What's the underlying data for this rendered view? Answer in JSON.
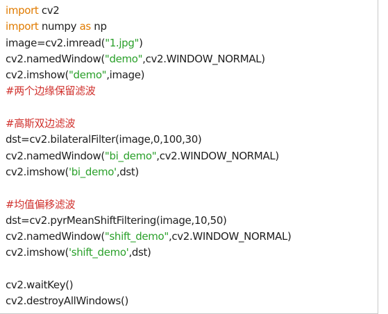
{
  "colors": {
    "keyword": "#e07b00",
    "string": "#2aa02a",
    "comment": "#d0312d",
    "text": "#1e1e1e",
    "background": "#ffffff"
  },
  "code_lines": [
    [
      {
        "t": "kw",
        "v": "import"
      },
      {
        "t": "pl",
        "v": " cv2"
      }
    ],
    [
      {
        "t": "kw",
        "v": "import"
      },
      {
        "t": "pl",
        "v": " numpy "
      },
      {
        "t": "kw",
        "v": "as"
      },
      {
        "t": "pl",
        "v": " np"
      }
    ],
    [
      {
        "t": "pl",
        "v": "image=cv2.imread("
      },
      {
        "t": "str",
        "v": "\"1.jpg\""
      },
      {
        "t": "pl",
        "v": ")"
      }
    ],
    [
      {
        "t": "pl",
        "v": "cv2.namedWindow("
      },
      {
        "t": "str",
        "v": "\"demo\""
      },
      {
        "t": "pl",
        "v": ",cv2.WINDOW_NORMAL)"
      }
    ],
    [
      {
        "t": "pl",
        "v": "cv2.imshow("
      },
      {
        "t": "str",
        "v": "\"demo\""
      },
      {
        "t": "pl",
        "v": ",image)"
      }
    ],
    [
      {
        "t": "cm",
        "v": "#两个边缘保留滤波"
      }
    ],
    [],
    [
      {
        "t": "cm",
        "v": "#高斯双边滤波"
      }
    ],
    [
      {
        "t": "pl",
        "v": "dst=cv2.bilateralFilter(image,0,100,30)"
      }
    ],
    [
      {
        "t": "pl",
        "v": "cv2.namedWindow("
      },
      {
        "t": "str",
        "v": "\"bi_demo\""
      },
      {
        "t": "pl",
        "v": ",cv2.WINDOW_NORMAL)"
      }
    ],
    [
      {
        "t": "pl",
        "v": "cv2.imshow("
      },
      {
        "t": "str",
        "v": "'bi_demo'"
      },
      {
        "t": "pl",
        "v": ",dst)"
      }
    ],
    [],
    [
      {
        "t": "cm",
        "v": "#均值偏移滤波"
      }
    ],
    [
      {
        "t": "pl",
        "v": "dst=cv2.pyrMeanShiftFiltering(image,10,50)"
      }
    ],
    [
      {
        "t": "pl",
        "v": "cv2.namedWindow("
      },
      {
        "t": "str",
        "v": "\"shift_demo\""
      },
      {
        "t": "pl",
        "v": ",cv2.WINDOW_NORMAL)"
      }
    ],
    [
      {
        "t": "pl",
        "v": "cv2.imshow("
      },
      {
        "t": "str",
        "v": "'shift_demo'"
      },
      {
        "t": "pl",
        "v": ",dst)"
      }
    ],
    [],
    [
      {
        "t": "pl",
        "v": "cv2.waitKey()"
      }
    ],
    [
      {
        "t": "pl",
        "v": "cv2.destroyAllWindows()"
      }
    ]
  ]
}
